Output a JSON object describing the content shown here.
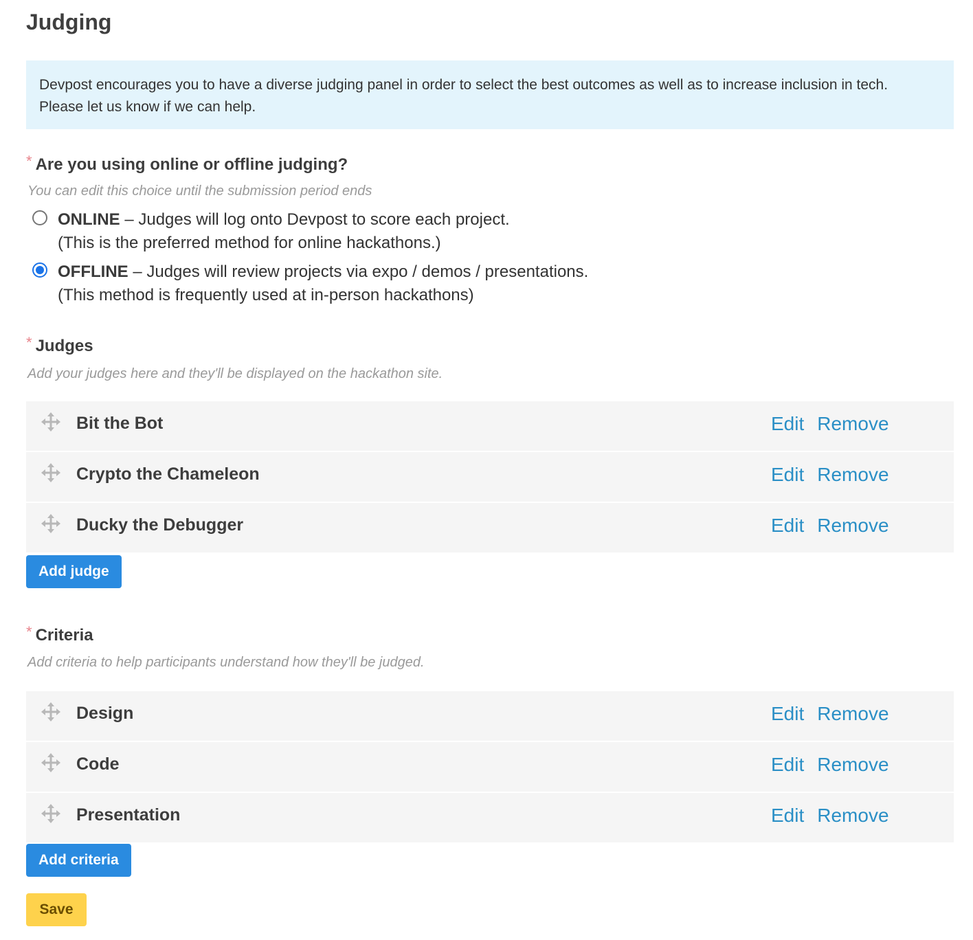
{
  "page": {
    "title": "Judging"
  },
  "info": {
    "line1": "Devpost encourages you to have a diverse judging panel in order to select the best outcomes as well as to increase inclusion in tech.",
    "line2": "Please let us know if we can help."
  },
  "judging_mode": {
    "required_mark": "*",
    "label": "Are you using online or offline judging?",
    "hint": "You can edit this choice until the submission period ends",
    "selected": "OFFLINE",
    "options": [
      {
        "name": "ONLINE",
        "desc": " – Judges will log onto Devpost to score each project.",
        "note": "(This is the preferred method for online hackathons.)",
        "checked": false
      },
      {
        "name": "OFFLINE",
        "desc": " – Judges will review projects via expo / demos / presentations.",
        "note": "(This method is frequently used at in-person hackathons)",
        "checked": true
      }
    ]
  },
  "judges": {
    "required_mark": "*",
    "label": "Judges",
    "hint": "Add your judges here and they'll be displayed on the hackathon site.",
    "items": [
      {
        "name": "Bit the Bot",
        "edit": "Edit",
        "remove": "Remove"
      },
      {
        "name": "Crypto the Chameleon",
        "edit": "Edit",
        "remove": "Remove"
      },
      {
        "name": "Ducky the Debugger",
        "edit": "Edit",
        "remove": "Remove"
      }
    ],
    "add_button": "Add judge"
  },
  "criteria": {
    "required_mark": "*",
    "label": "Criteria",
    "hint": "Add criteria to help participants understand how they'll be judged.",
    "items": [
      {
        "name": "Design",
        "edit": "Edit",
        "remove": "Remove"
      },
      {
        "name": "Code",
        "edit": "Edit",
        "remove": "Remove"
      },
      {
        "name": "Presentation",
        "edit": "Edit",
        "remove": "Remove"
      }
    ],
    "add_button": "Add criteria"
  },
  "save_button": "Save",
  "colors": {
    "link": "#2a8fc6",
    "primary_button": "#2a8be0",
    "save_button": "#fed24c",
    "info_background": "#e3f4fc",
    "required_asterisk": "#e8848c"
  },
  "icons": {
    "drag": "move-arrows-icon"
  }
}
